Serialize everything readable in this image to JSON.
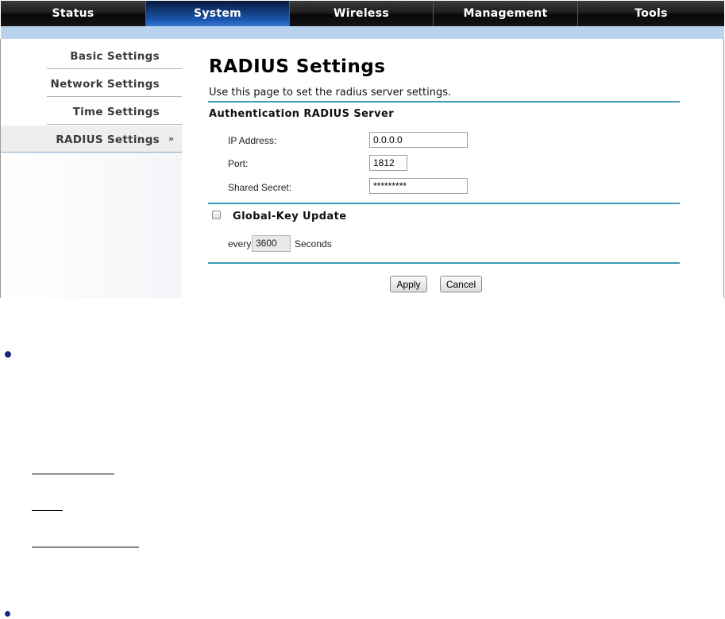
{
  "nav": {
    "tabs": [
      {
        "label": "Status"
      },
      {
        "label": "System"
      },
      {
        "label": "Wireless"
      },
      {
        "label": "Management"
      },
      {
        "label": "Tools"
      }
    ]
  },
  "sidebar": {
    "items": [
      {
        "label": "Basic Settings"
      },
      {
        "label": "Network Settings"
      },
      {
        "label": "Time Settings"
      },
      {
        "label": "RADIUS Settings"
      }
    ],
    "active_marker": "»"
  },
  "page": {
    "title": "RADIUS Settings",
    "description": "Use this page to set the radius server settings.",
    "section_title": "Authentication RADIUS Server"
  },
  "form": {
    "ip_label": "IP Address:",
    "ip_value": "0.0.0.0",
    "port_label": "Port:",
    "port_value": "1812",
    "secret_label": "Shared Secret:",
    "secret_value": "*********",
    "global_key_label": "Global-Key Update",
    "every_label": "every",
    "interval_value": "3600",
    "seconds_label": "Seconds"
  },
  "buttons": {
    "apply": "Apply",
    "cancel": "Cancel"
  },
  "colors": {
    "accent_rule": "#3a9bb2",
    "active_tab": "#1b56b0",
    "band": "#b9d3ee",
    "bullet": "#1a237e"
  }
}
